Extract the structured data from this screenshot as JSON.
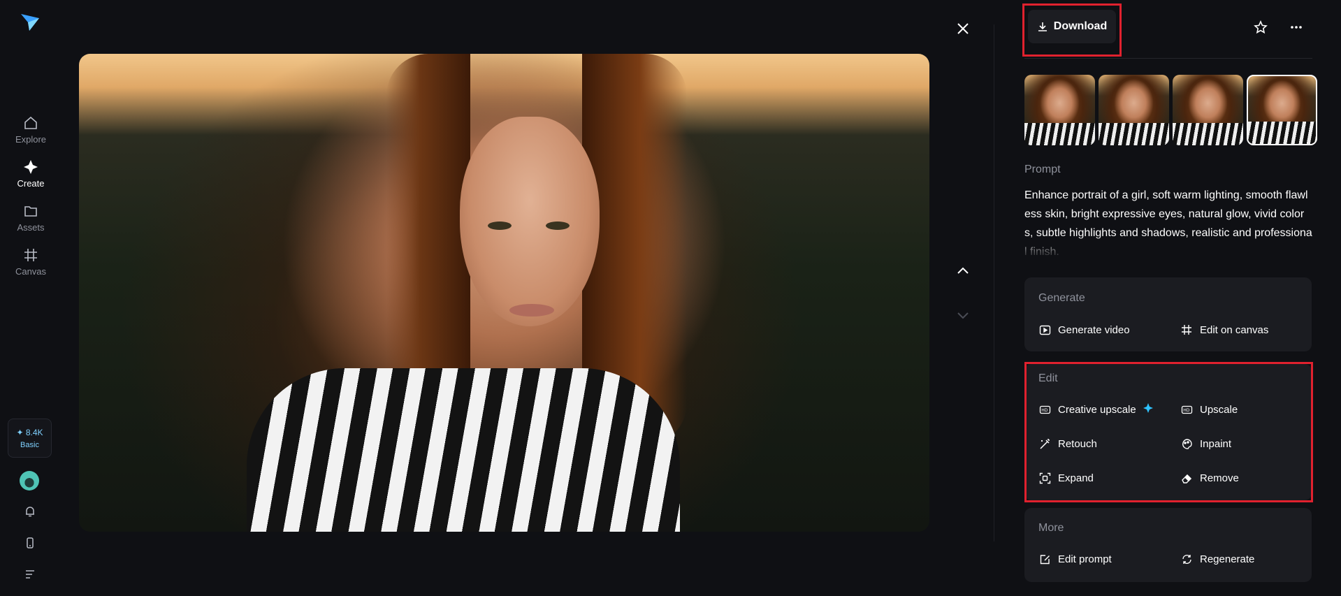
{
  "nav": {
    "items": [
      {
        "label": "Explore",
        "icon": "home-icon"
      },
      {
        "label": "Create",
        "icon": "sparkle-icon"
      },
      {
        "label": "Assets",
        "icon": "folder-icon"
      },
      {
        "label": "Canvas",
        "icon": "canvas-grid-icon"
      }
    ],
    "credits": {
      "amount": "✦ 8.4K",
      "plan": "Basic"
    }
  },
  "toolbar": {
    "download_label": "Download"
  },
  "prompt": {
    "label": "Prompt",
    "text": "Enhance portrait of a girl, soft warm lighting, smooth flawless skin, bright expressive eyes, natural glow, vivid colors, subtle highlights and shadows, realistic and professional finish."
  },
  "generate": {
    "title": "Generate",
    "items": [
      {
        "label": "Generate video",
        "icon": "play-video-icon"
      },
      {
        "label": "Edit on canvas",
        "icon": "canvas-grid-icon"
      }
    ]
  },
  "edit": {
    "title": "Edit",
    "items": [
      {
        "label": "Creative upscale",
        "icon": "hd-plus-icon"
      },
      {
        "label": "Upscale",
        "icon": "hd-icon"
      },
      {
        "label": "Retouch",
        "icon": "magic-wand-icon"
      },
      {
        "label": "Inpaint",
        "icon": "paint-palette-icon"
      },
      {
        "label": "Expand",
        "icon": "expand-frame-icon"
      },
      {
        "label": "Remove",
        "icon": "eraser-icon"
      }
    ]
  },
  "more": {
    "title": "More",
    "items": [
      {
        "label": "Edit prompt",
        "icon": "edit-prompt-icon"
      },
      {
        "label": "Regenerate",
        "icon": "refresh-icon"
      }
    ]
  },
  "colors": {
    "background": "#0f1014",
    "card": "#1b1c21",
    "highlight": "#e0212e",
    "accent": "#7fd1ff"
  }
}
